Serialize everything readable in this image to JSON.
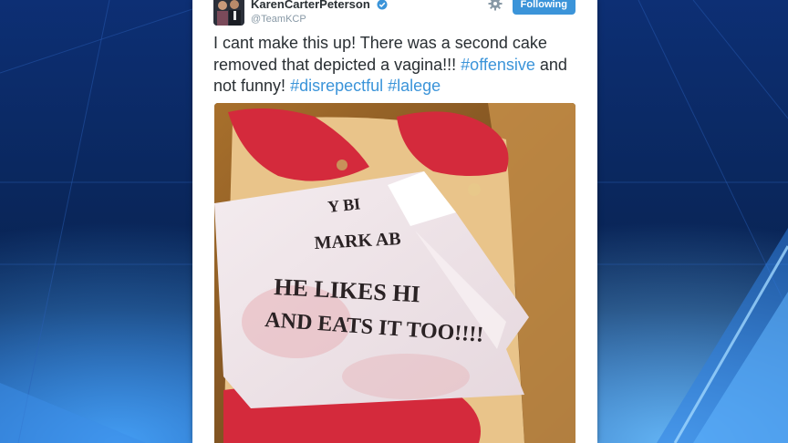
{
  "tweet": {
    "display_name": "KarenCarterPeterson",
    "handle": "@TeamKCP",
    "follow_label": "Following",
    "text_parts": [
      "I cant make this up! There was a second cake removed that depicted a vagina!!! ",
      "#offensive",
      " and not funny! ",
      "#disrepectful",
      " ",
      "#lalege"
    ]
  },
  "photo": {
    "note_lines": [
      "Y BI",
      "MARK AB",
      "HE LIKES HI",
      "AND EATS IT TOO!!!!"
    ]
  },
  "icons": {
    "verified": "verified-badge-icon",
    "settings": "gear-icon"
  },
  "colors": {
    "link": "#3b94d9",
    "follow_button": "#3b94d9",
    "text": "#292f33",
    "handle": "#8899a6",
    "background": "#0a2a66",
    "frosting": "#d42a3c"
  }
}
